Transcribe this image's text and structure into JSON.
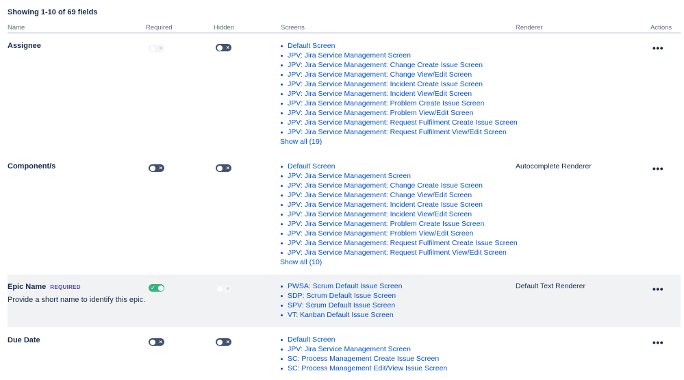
{
  "summary": "Showing 1-10 of 69 fields",
  "headers": {
    "name": "Name",
    "required": "Required",
    "hidden": "Hidden",
    "screens": "Screens",
    "renderer": "Renderer",
    "actions": "Actions"
  },
  "toggle_glyphs": {
    "on": "✓",
    "off": "×"
  },
  "actions_glyph": "•••",
  "colors": {
    "link": "#0052cc",
    "toggle_off": "#42526e",
    "toggle_on": "#36b37e",
    "badge": "#5243aa",
    "highlight_row": "#f1f2f4"
  },
  "fields": [
    {
      "name": "Assignee",
      "required": "disabled-off",
      "hidden": "off",
      "screens": [
        "Default Screen",
        "JPV: Jira Service Management Screen",
        "JPV: Jira Service Management: Change Create Issue Screen",
        "JPV: Jira Service Management: Change View/Edit Screen",
        "JPV: Jira Service Management: Incident Create Issue Screen",
        "JPV: Jira Service Management: Incident View/Edit Screen",
        "JPV: Jira Service Management: Problem Create Issue Screen",
        "JPV: Jira Service Management: Problem View/Edit Screen",
        "JPV: Jira Service Management: Request Fulfilment Create Issue Screen",
        "JPV: Jira Service Management: Request Fulfilment View/Edit Screen"
      ],
      "show_all": "Show all (19)",
      "renderer": ""
    },
    {
      "name": "Component/s",
      "required": "off",
      "hidden": "off",
      "screens": [
        "Default Screen",
        "JPV: Jira Service Management Screen",
        "JPV: Jira Service Management: Change Create Issue Screen",
        "JPV: Jira Service Management: Change View/Edit Screen",
        "JPV: Jira Service Management: Incident Create Issue Screen",
        "JPV: Jira Service Management: Incident View/Edit Screen",
        "JPV: Jira Service Management: Problem Create Issue Screen",
        "JPV: Jira Service Management: Problem View/Edit Screen",
        "JPV: Jira Service Management: Request Fulfilment Create Issue Screen",
        "JPV: Jira Service Management: Request Fulfilment View/Edit Screen"
      ],
      "show_all": "Show all (10)",
      "renderer": "Autocomplete Renderer"
    },
    {
      "name": "Epic Name",
      "badge": "REQUIRED",
      "description": "Provide a short name to identify this epic.",
      "required": "on",
      "hidden": "disabled-off",
      "screens": [
        "PWSA: Scrum Default Issue Screen",
        "SDP: Scrum Default Issue Screen",
        "SPV: Scrum Default Issue Screen",
        "VT: Kanban Default Issue Screen"
      ],
      "show_all": "",
      "renderer": "Default Text Renderer"
    },
    {
      "name": "Due Date",
      "required": "off",
      "hidden": "off",
      "screens": [
        "Default Screen",
        "JPV: Jira Service Management Screen",
        "SC: Process Management Create Issue Screen",
        "SC: Process Management Edit/View Issue Screen"
      ],
      "show_all": "",
      "renderer": ""
    }
  ]
}
